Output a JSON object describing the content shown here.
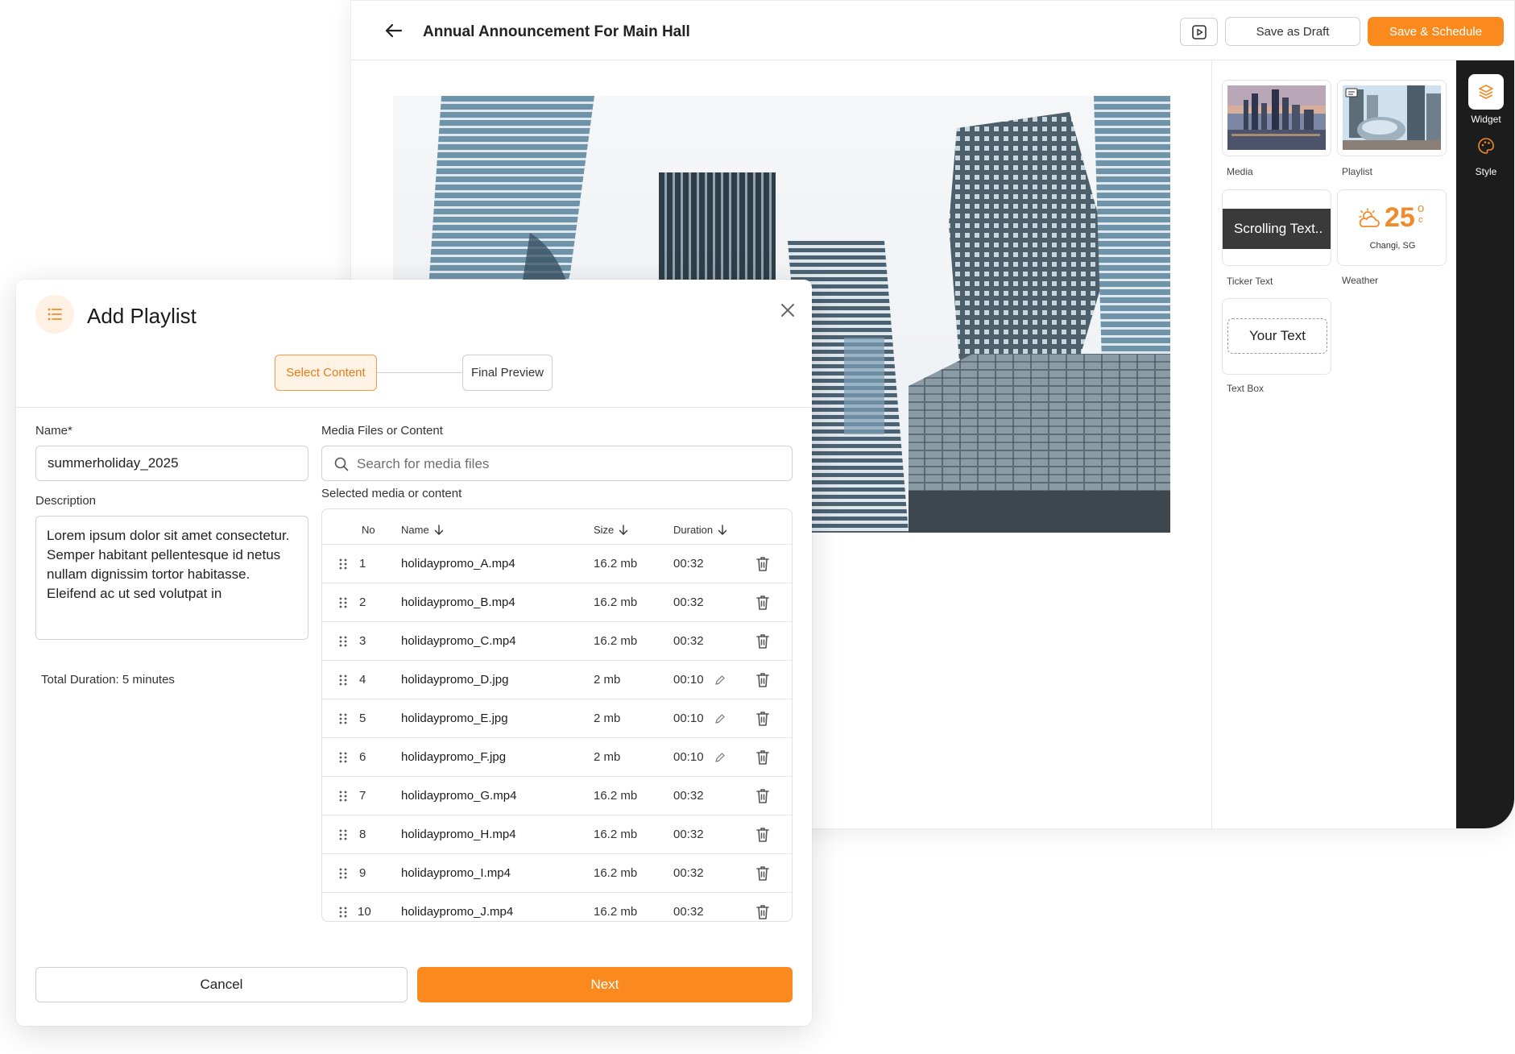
{
  "editor": {
    "title": "Annual Announcement For Main Hall",
    "save_draft_label": "Save as Draft",
    "save_schedule_label": "Save & Schedule",
    "icons": {
      "back": "arrow-left-icon",
      "preview": "play-icon"
    }
  },
  "widgets": {
    "items": [
      {
        "label": "Media",
        "icon": "city-skyline-thumbnail"
      },
      {
        "label": "Playlist",
        "icon": "bean-sculpture-thumbnail"
      },
      {
        "label": "Ticker Text",
        "preview_text": "Scrolling Text.."
      },
      {
        "label": "Weather",
        "temperature": "25",
        "unit_degree": "o",
        "unit_c": "c",
        "location": "Changi, SG"
      },
      {
        "label": "Text Box",
        "preview_text": "Your Text"
      }
    ]
  },
  "rail": {
    "items": [
      {
        "label": "Widget",
        "icon": "layers-icon",
        "active": true
      },
      {
        "label": "Style",
        "icon": "palette-icon",
        "active": false
      }
    ]
  },
  "modal": {
    "title": "Add Playlist",
    "steps": [
      {
        "label": "Select Content",
        "active": true
      },
      {
        "label": "Final Preview",
        "active": false
      }
    ],
    "name_label": "Name*",
    "name_value": "summerholiday_2025",
    "description_label": "Description",
    "description_value": "Lorem ipsum dolor sit amet consectetur. Semper habitant pellentesque id netus nullam dignissim tortor habitasse. Eleifend ac ut sed volutpat in",
    "total_duration": "Total Duration: 5 minutes",
    "media_label": "Media Files or Content",
    "search_placeholder": "Search for media files",
    "selected_label": "Selected media or content",
    "table": {
      "headers": {
        "no": "No",
        "name": "Name",
        "size": "Size",
        "duration": "Duration"
      },
      "rows": [
        {
          "no": "1",
          "name": "holidaypromo_A.mp4",
          "size": "16.2 mb",
          "duration": "00:32",
          "editable": false
        },
        {
          "no": "2",
          "name": "holidaypromo_B.mp4",
          "size": "16.2 mb",
          "duration": "00:32",
          "editable": false
        },
        {
          "no": "3",
          "name": "holidaypromo_C.mp4",
          "size": "16.2 mb",
          "duration": "00:32",
          "editable": false
        },
        {
          "no": "4",
          "name": "holidaypromo_D.jpg",
          "size": "2 mb",
          "duration": "00:10",
          "editable": true
        },
        {
          "no": "5",
          "name": "holidaypromo_E.jpg",
          "size": "2 mb",
          "duration": "00:10",
          "editable": true
        },
        {
          "no": "6",
          "name": "holidaypromo_F.jpg",
          "size": "2 mb",
          "duration": "00:10",
          "editable": true
        },
        {
          "no": "7",
          "name": "holidaypromo_G.mp4",
          "size": "16.2 mb",
          "duration": "00:32",
          "editable": false
        },
        {
          "no": "8",
          "name": "holidaypromo_H.mp4",
          "size": "16.2 mb",
          "duration": "00:32",
          "editable": false
        },
        {
          "no": "9",
          "name": "holidaypromo_I.mp4",
          "size": "16.2 mb",
          "duration": "00:32",
          "editable": false
        },
        {
          "no": "10",
          "name": "holidaypromo_J.mp4",
          "size": "16.2 mb",
          "duration": "00:32",
          "editable": false
        }
      ]
    },
    "cancel_label": "Cancel",
    "next_label": "Next"
  },
  "colors": {
    "accent": "#fb8a1e",
    "accent_soft": "#fff3e6",
    "rail_bg": "#1c1c1c",
    "border": "#d2d2d2"
  }
}
